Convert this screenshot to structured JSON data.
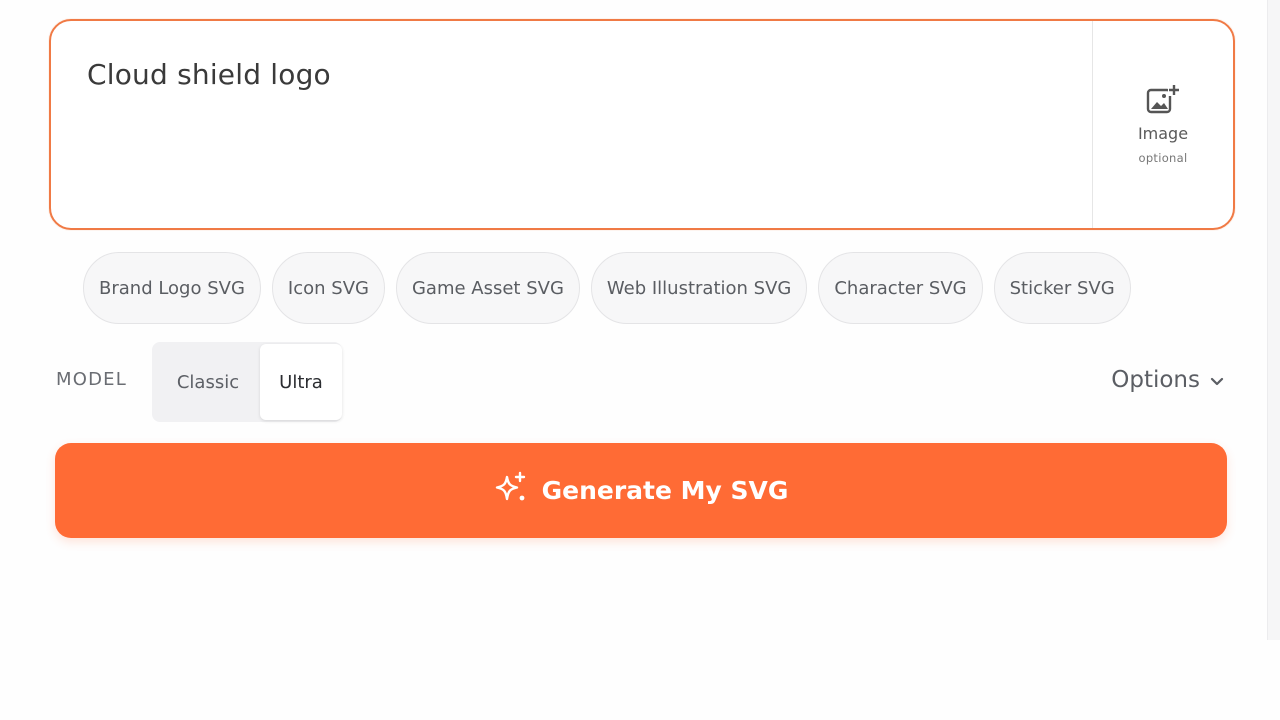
{
  "prompt": {
    "value": "Cloud shield logo"
  },
  "image_upload": {
    "icon": "image-add-icon",
    "label": "Image",
    "sublabel": "optional"
  },
  "chips": [
    {
      "label": "Brand Logo SVG"
    },
    {
      "label": "Icon SVG"
    },
    {
      "label": "Game Asset SVG"
    },
    {
      "label": "Web Illustration SVG"
    },
    {
      "label": "Character SVG"
    },
    {
      "label": "Sticker SVG"
    }
  ],
  "model": {
    "label": "MODEL",
    "options": [
      {
        "label": "Classic",
        "selected": false
      },
      {
        "label": "Ultra",
        "selected": true
      }
    ]
  },
  "options_toggle": {
    "label": "Options",
    "icon": "chevron-down-icon"
  },
  "generate_button": {
    "label": "Generate My SVG",
    "icon": "sparkle-icon"
  },
  "colors": {
    "accent": "#ff6b35",
    "border_accent": "#f07a45"
  }
}
